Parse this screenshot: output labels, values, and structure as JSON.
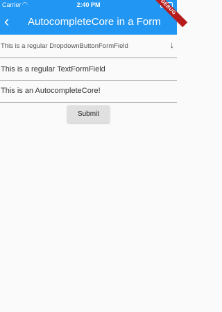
{
  "status_bar": {
    "carrier": "Carrier",
    "time": "2:40 PM"
  },
  "app_bar": {
    "title": "AutocompleteCore in a Form",
    "debug_banner": "DEBUG"
  },
  "form": {
    "dropdown": {
      "placeholder": "This is a regular DropdownButtonFormField"
    },
    "text_field": {
      "placeholder": "This is a regular TextFormField"
    },
    "autocomplete": {
      "placeholder": "This is an AutocompleteCore!"
    },
    "submit_label": "Submit"
  },
  "colors": {
    "primary": "#2196f3",
    "debug": "#b71c1c",
    "background": "#fafafa"
  }
}
